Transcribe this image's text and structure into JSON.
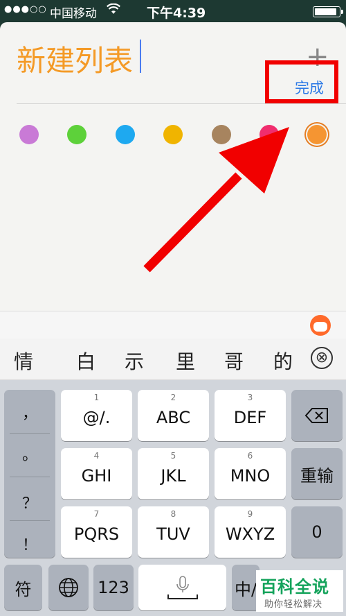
{
  "status_bar": {
    "signal": "●●●○○",
    "carrier": "中国移动",
    "time": "下午4:39",
    "battery_level": 0.95
  },
  "sheet": {
    "title": "新建列表",
    "plus": "+",
    "done_label": "完成",
    "highlight_color": "#f10000",
    "accent_color": "#f49a26"
  },
  "colors": [
    {
      "name": "purple",
      "hex": "#c97ad6"
    },
    {
      "name": "green",
      "hex": "#5dd13a"
    },
    {
      "name": "blue",
      "hex": "#1ea9f0"
    },
    {
      "name": "yellow",
      "hex": "#f0b400"
    },
    {
      "name": "brown",
      "hex": "#a7845f"
    },
    {
      "name": "pink",
      "hex": "#f02d6e"
    },
    {
      "name": "orange",
      "hex": "#f59532",
      "selected": true
    }
  ],
  "candidates": [
    "情",
    "白",
    "示",
    "里",
    "哥",
    "的"
  ],
  "candidate_close": "⊗",
  "keyboard": {
    "punctuation": [
      "，",
      "。",
      "？",
      "！"
    ],
    "rows": [
      [
        {
          "num": "1",
          "label": "@/."
        },
        {
          "num": "2",
          "label": "ABC"
        },
        {
          "num": "3",
          "label": "DEF"
        }
      ],
      [
        {
          "num": "4",
          "label": "GHI"
        },
        {
          "num": "5",
          "label": "JKL"
        },
        {
          "num": "6",
          "label": "MNO"
        }
      ],
      [
        {
          "num": "7",
          "label": "PQRS"
        },
        {
          "num": "8",
          "label": "TUV"
        },
        {
          "num": "9",
          "label": "WXYZ"
        }
      ]
    ],
    "delete": "⌫",
    "reinput": "重输",
    "zero": "0",
    "bottom": {
      "symbol": "符",
      "globe": "🌐",
      "numbers": "123",
      "lang": "中/"
    }
  },
  "watermark": {
    "title": "百科全说",
    "subtitle": "助你轻松解决"
  }
}
